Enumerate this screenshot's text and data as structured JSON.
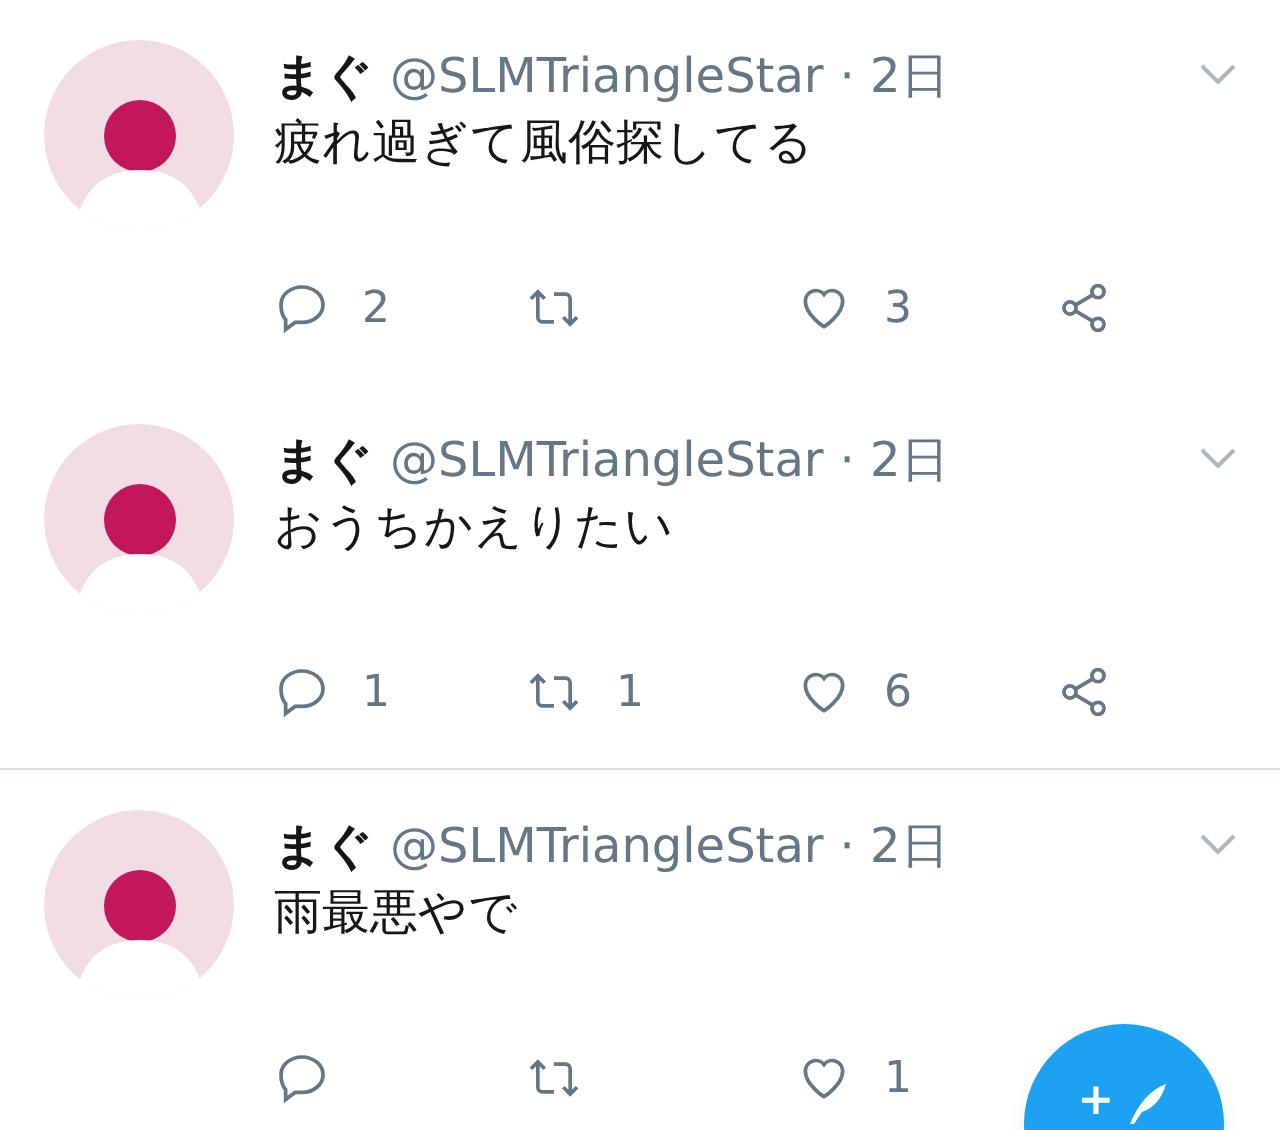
{
  "tweets": [
    {
      "name": "まぐ",
      "handle": "@SLMTriangleStar",
      "time": "· 2日",
      "text": "疲れ過ぎて風俗探してる",
      "divider": false,
      "replies": "2",
      "likes": "3",
      "share": true
    },
    {
      "name": "まぐ",
      "handle": "@SLMTriangleStar",
      "time": "· 2日",
      "text": "おうちかえりたい",
      "divider": false,
      "replies": "1",
      "retweets": "1",
      "likes": "6",
      "share": true
    },
    {
      "name": "まぐ",
      "handle": "@SLMTriangleStar",
      "time": "· 2日",
      "text": "雨最悪やで",
      "divider": true,
      "likes": "1",
      "share": false
    }
  ],
  "compose_button": {
    "label": "+"
  }
}
